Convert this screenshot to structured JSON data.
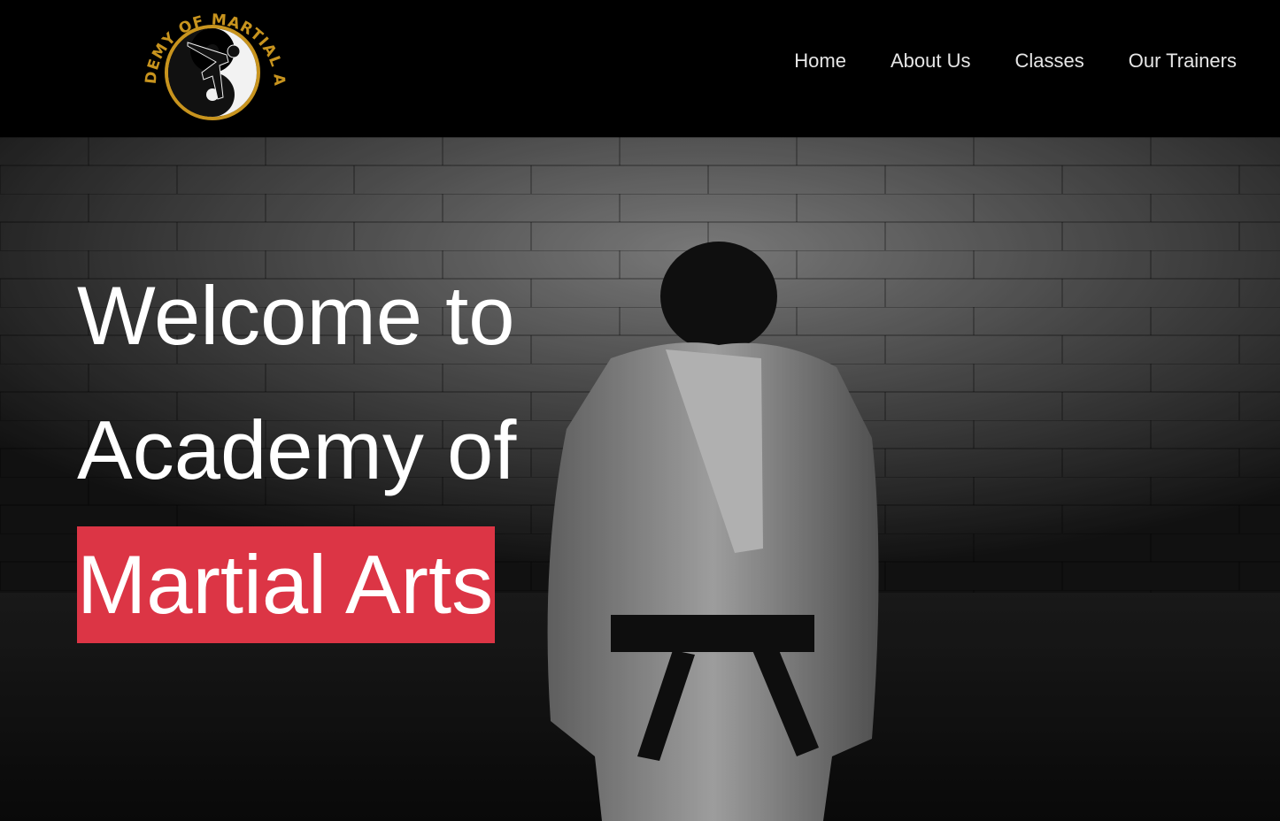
{
  "site": {
    "logo_text": "ACADEMY OF MARTIAL ARTS",
    "logo_icon": "martial-artist-kick-emblem",
    "accent_color": "#dc3545",
    "logo_gold": "#c8941e"
  },
  "nav": {
    "items": [
      {
        "label": "Home"
      },
      {
        "label": "About Us"
      },
      {
        "label": "Classes"
      },
      {
        "label": "Our Trainers"
      }
    ]
  },
  "hero": {
    "line1": "Welcome to",
    "line2": "Academy of",
    "highlight": "Martial Arts",
    "background": "martial-artist-bowing-photo"
  }
}
